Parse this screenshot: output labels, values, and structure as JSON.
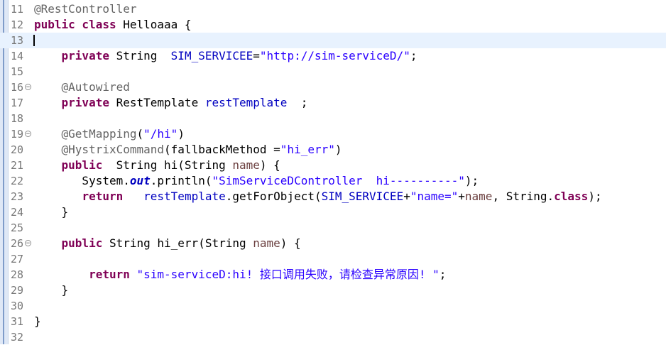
{
  "editor": {
    "lines": [
      {
        "num": "11",
        "fold": false,
        "segments": [
          {
            "t": "@RestController",
            "c": "an"
          }
        ]
      },
      {
        "num": "12",
        "fold": false,
        "segments": [
          {
            "t": "public class ",
            "c": "kw"
          },
          {
            "t": "Helloaaa {",
            "c": "cn"
          }
        ]
      },
      {
        "num": "13",
        "fold": false,
        "current": true,
        "segments": []
      },
      {
        "num": "14",
        "fold": false,
        "segments": [
          {
            "t": "    ",
            "c": "cn"
          },
          {
            "t": "private",
            "c": "kw"
          },
          {
            "t": " String  ",
            "c": "cn"
          },
          {
            "t": "SIM_SERVICEE",
            "c": "fd"
          },
          {
            "t": "=",
            "c": "cn"
          },
          {
            "t": "\"http://sim-serviceD/\"",
            "c": "st"
          },
          {
            "t": ";",
            "c": "cn"
          }
        ]
      },
      {
        "num": "15",
        "fold": false,
        "segments": []
      },
      {
        "num": "16",
        "fold": true,
        "segments": [
          {
            "t": "    ",
            "c": "cn"
          },
          {
            "t": "@Autowired",
            "c": "an"
          }
        ]
      },
      {
        "num": "17",
        "fold": false,
        "segments": [
          {
            "t": "    ",
            "c": "cn"
          },
          {
            "t": "private",
            "c": "kw"
          },
          {
            "t": " RestTemplate ",
            "c": "cn"
          },
          {
            "t": "restTemplate",
            "c": "fd"
          },
          {
            "t": "  ;",
            "c": "cn"
          }
        ]
      },
      {
        "num": "18",
        "fold": false,
        "segments": []
      },
      {
        "num": "19",
        "fold": true,
        "segments": [
          {
            "t": "    ",
            "c": "cn"
          },
          {
            "t": "@GetMapping",
            "c": "an"
          },
          {
            "t": "(",
            "c": "cn"
          },
          {
            "t": "\"/hi\"",
            "c": "st"
          },
          {
            "t": ")",
            "c": "cn"
          }
        ]
      },
      {
        "num": "20",
        "fold": false,
        "segments": [
          {
            "t": "    ",
            "c": "cn"
          },
          {
            "t": "@HystrixCommand",
            "c": "an"
          },
          {
            "t": "(fallbackMethod =",
            "c": "cn"
          },
          {
            "t": "\"hi_err\"",
            "c": "st"
          },
          {
            "t": ")",
            "c": "cn"
          }
        ]
      },
      {
        "num": "21",
        "fold": false,
        "segments": [
          {
            "t": "    ",
            "c": "cn"
          },
          {
            "t": "public",
            "c": "kw"
          },
          {
            "t": "  String hi(String ",
            "c": "cn"
          },
          {
            "t": "name",
            "c": "pr"
          },
          {
            "t": ") {",
            "c": "cn"
          }
        ]
      },
      {
        "num": "22",
        "fold": false,
        "segments": [
          {
            "t": "       System.",
            "c": "cn"
          },
          {
            "t": "out",
            "c": "so"
          },
          {
            "t": ".println(",
            "c": "cn"
          },
          {
            "t": "\"SimServiceDController  hi----------\"",
            "c": "st"
          },
          {
            "t": ");",
            "c": "cn"
          }
        ]
      },
      {
        "num": "23",
        "fold": false,
        "segments": [
          {
            "t": "       ",
            "c": "cn"
          },
          {
            "t": "return",
            "c": "kw"
          },
          {
            "t": "   ",
            "c": "cn"
          },
          {
            "t": "restTemplate",
            "c": "fd"
          },
          {
            "t": ".getForObject(",
            "c": "cn"
          },
          {
            "t": "SIM_SERVICEE",
            "c": "fd"
          },
          {
            "t": "+",
            "c": "cn"
          },
          {
            "t": "\"name=\"",
            "c": "st"
          },
          {
            "t": "+",
            "c": "cn"
          },
          {
            "t": "name",
            "c": "pr"
          },
          {
            "t": ", String.",
            "c": "cn"
          },
          {
            "t": "class",
            "c": "kw"
          },
          {
            "t": ");",
            "c": "cn"
          }
        ]
      },
      {
        "num": "24",
        "fold": false,
        "segments": [
          {
            "t": "    }",
            "c": "cn"
          }
        ]
      },
      {
        "num": "25",
        "fold": false,
        "segments": []
      },
      {
        "num": "26",
        "fold": true,
        "segments": [
          {
            "t": "    ",
            "c": "cn"
          },
          {
            "t": "public",
            "c": "kw"
          },
          {
            "t": " String hi_err(String ",
            "c": "cn"
          },
          {
            "t": "name",
            "c": "pr"
          },
          {
            "t": ") {",
            "c": "cn"
          }
        ]
      },
      {
        "num": "27",
        "fold": false,
        "segments": []
      },
      {
        "num": "28",
        "fold": false,
        "segments": [
          {
            "t": "        ",
            "c": "cn"
          },
          {
            "t": "return",
            "c": "kw"
          },
          {
            "t": " ",
            "c": "cn"
          },
          {
            "t": "\"sim-serviceD:hi! 接口调用失败，请检查异常原因! \"",
            "c": "st"
          },
          {
            "t": ";",
            "c": "cn"
          }
        ]
      },
      {
        "num": "29",
        "fold": false,
        "segments": [
          {
            "t": "    }",
            "c": "cn"
          }
        ]
      },
      {
        "num": "30",
        "fold": false,
        "segments": []
      },
      {
        "num": "31",
        "fold": false,
        "segments": [
          {
            "t": "}",
            "c": "cn"
          }
        ]
      },
      {
        "num": "32",
        "fold": false,
        "segments": []
      }
    ]
  },
  "colors": {
    "keyword": "#7f0055",
    "annotation": "#646464",
    "string": "#2a00ff",
    "field": "#0000c0",
    "parameter": "#6a3e3e",
    "current_line": "#e8f2fe",
    "line_number": "#787878"
  },
  "icons": {
    "fold": "fold-collapse-icon"
  }
}
